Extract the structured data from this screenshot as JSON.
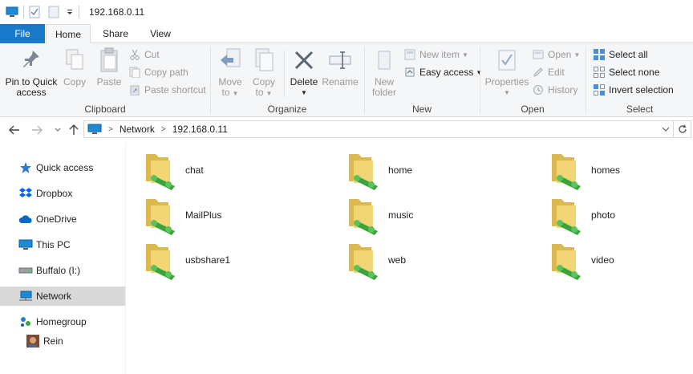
{
  "titlebar": {
    "path": "192.168.0.11"
  },
  "ribbon_tabs": [
    {
      "label": "File"
    },
    {
      "label": "Home"
    },
    {
      "label": "Share"
    },
    {
      "label": "View"
    }
  ],
  "clipboard": {
    "label": "Clipboard",
    "pin_label_1": "Pin to Quick",
    "pin_label_2": "access",
    "copy": "Copy",
    "paste": "Paste",
    "cut": "Cut",
    "copy_path": "Copy path",
    "paste_shortcut": "Paste shortcut"
  },
  "organize": {
    "label": "Organize",
    "move_to_1": "Move",
    "move_to_2": "to",
    "copy_to_1": "Copy",
    "copy_to_2": "to",
    "delete": "Delete",
    "rename": "Rename"
  },
  "new_group": {
    "label": "New",
    "new_folder_1": "New",
    "new_folder_2": "folder",
    "new_item": "New item",
    "easy_access": "Easy access"
  },
  "open_group": {
    "label": "Open",
    "properties": "Properties",
    "open": "Open",
    "edit": "Edit",
    "history": "History"
  },
  "select_group": {
    "label": "Select",
    "select_all": "Select all",
    "select_none": "Select none",
    "invert_selection": "Invert selection"
  },
  "address": {
    "crumbs": [
      "Network",
      "192.168.0.11"
    ]
  },
  "nav_pane": [
    {
      "label": "Quick access",
      "icon": "star-icon"
    },
    {
      "label": "Dropbox",
      "icon": "dropbox-icon"
    },
    {
      "label": "OneDrive",
      "icon": "cloud-icon"
    },
    {
      "label": "This PC",
      "icon": "computer-icon"
    },
    {
      "label": "Buffalo (I:)",
      "icon": "drive-icon"
    },
    {
      "label": "Network",
      "icon": "network-icon"
    },
    {
      "label": "Homegroup",
      "icon": "homegroup-icon"
    },
    {
      "label": "Rein",
      "icon": "user-avatar-icon"
    }
  ],
  "shares": [
    {
      "name": "chat"
    },
    {
      "name": "home"
    },
    {
      "name": "homes"
    },
    {
      "name": "MailPlus"
    },
    {
      "name": "music"
    },
    {
      "name": "photo"
    },
    {
      "name": "usbshare1"
    },
    {
      "name": "web"
    },
    {
      "name": "video"
    }
  ],
  "colors": {
    "file_tab": "#1979ca",
    "ribbon_bg": "#f5f6f7",
    "selected_nav": "#d9d9d9",
    "folder": "#f2d675",
    "pipe": "#3aa33a"
  }
}
